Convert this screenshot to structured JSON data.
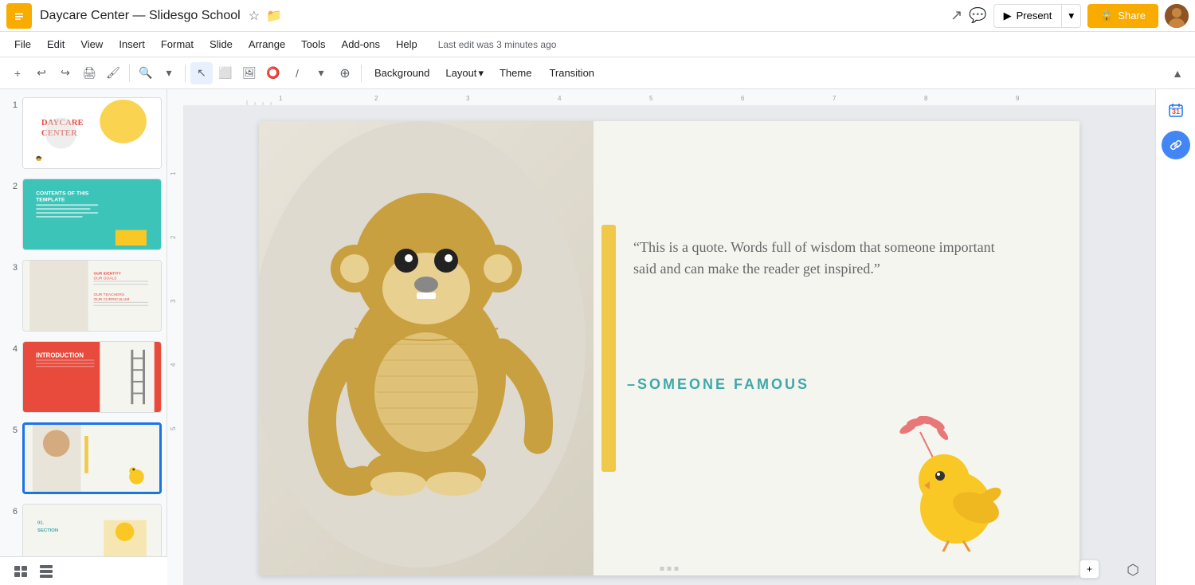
{
  "titleBar": {
    "docTitle": "Daycare Center — Slidesgo School",
    "lastEdit": "Last edit was 3 minutes ago",
    "presentLabel": "Present",
    "shareLabel": "Share"
  },
  "menuBar": {
    "items": [
      "File",
      "Edit",
      "View",
      "Insert",
      "Format",
      "Slide",
      "Arrange",
      "Tools",
      "Add-ons",
      "Help"
    ]
  },
  "toolbar": {
    "backgroundLabel": "Background",
    "layoutLabel": "Layout",
    "themeLabel": "Theme",
    "transitionLabel": "Transition"
  },
  "slidePanel": {
    "slides": [
      1,
      2,
      3,
      4,
      5,
      6
    ],
    "activeSlide": 5
  },
  "canvas": {
    "quote": "“This is a quote. Words full of wisdom that someone important said and can make the reader get inspired.”",
    "author": "–SOMEONE FAMOUS"
  },
  "ruler": {
    "hMarks": [
      1,
      2,
      3,
      4,
      5,
      6,
      7,
      8,
      9
    ],
    "vMarks": [
      1,
      2,
      3,
      4,
      5
    ]
  },
  "bottomBar": {
    "gridView": "grid-view",
    "listView": "list-view"
  }
}
